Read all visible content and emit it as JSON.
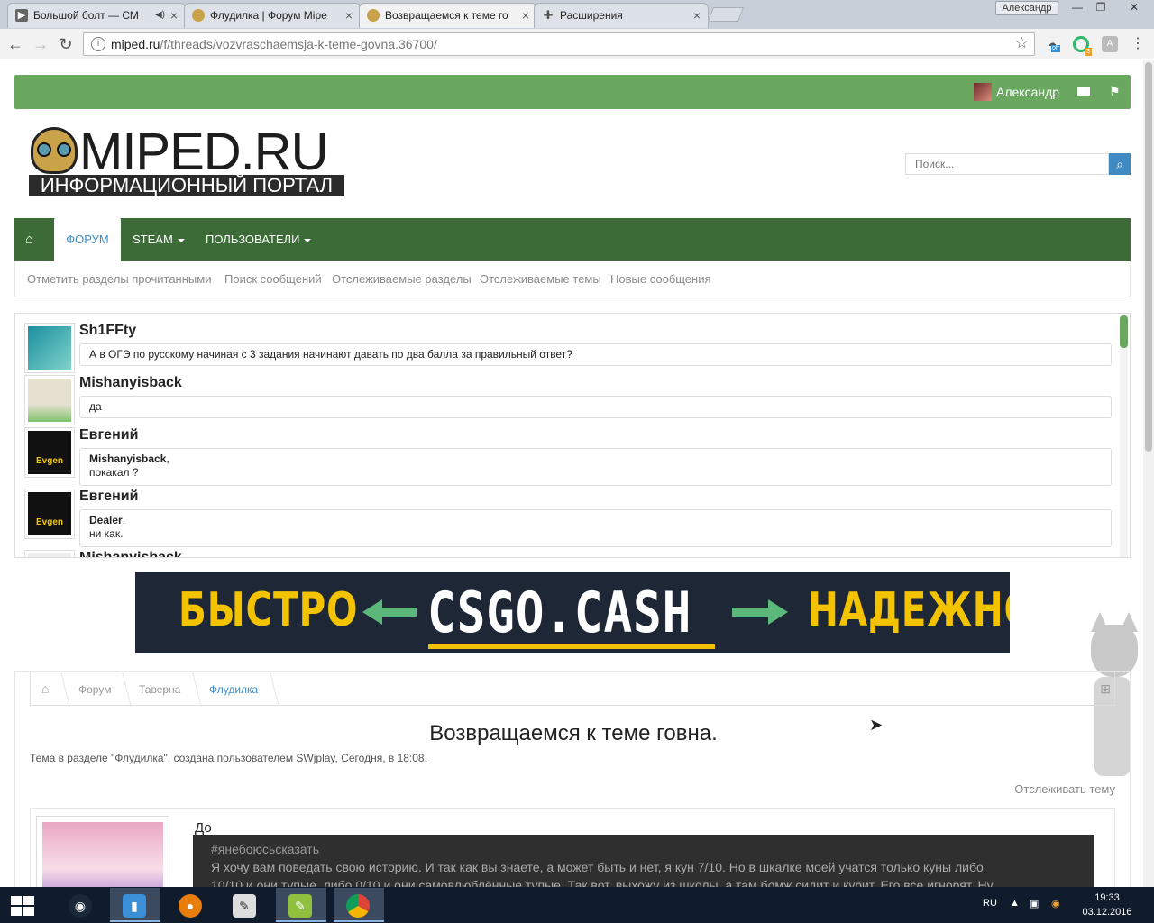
{
  "browser": {
    "tabs": [
      {
        "title": "Большой болт — СМ",
        "icon": "play-icon",
        "active": false
      },
      {
        "title": "Флудилка | Форум Mipe",
        "icon": "miped-favicon",
        "active": false
      },
      {
        "title": "Возвращаемся к теме го",
        "icon": "miped-favicon",
        "active": true
      },
      {
        "title": "Расширения",
        "icon": "puzzle-icon",
        "active": false
      }
    ],
    "profile_name": "Александр",
    "url_domain": "miped.ru",
    "url_path": "/f/threads/vozvraschaemsja-k-teme-govna.36700/",
    "ext_badges": [
      "off",
      "3"
    ]
  },
  "site": {
    "user": "Александр",
    "logo_title": "MIPED.RU",
    "logo_subtitle": "ИНФОРМАЦИОННЫЙ ПОРТАЛ",
    "search_placeholder": "Поиск...",
    "nav": {
      "forum": "ФОРУМ",
      "steam": "STEAM",
      "users": "ПОЛЬЗОВАТЕЛИ"
    },
    "subnav": [
      "Отметить разделы прочитанными",
      "Поиск сообщений",
      "Отслеживаемые разделы",
      "Отслеживаемые темы",
      "Новые сообщения"
    ]
  },
  "shoutbox": [
    {
      "name": "Sh1FFty",
      "lines": [
        "А в ОГЭ по русскому начиная с 3 задания начинают давать по два балла за правильный ответ?"
      ]
    },
    {
      "name": "Mishanyisback",
      "lines": [
        "да"
      ]
    },
    {
      "name": "Евгений",
      "mention": "Mishanyisback",
      "lines": [
        "покакал ?"
      ]
    },
    {
      "name": "Евгений",
      "mention": "Dealer",
      "lines": [
        "ни как."
      ]
    },
    {
      "name": "Mishanyisback",
      "lines": []
    }
  ],
  "banner": {
    "left": "БЫСТРО",
    "mid": "CSGO.CASH",
    "right": "НАДЕЖНО",
    "colors": {
      "yellow": "#f3c300",
      "green": "#5cb87a",
      "bg": "#1e2735"
    }
  },
  "thread": {
    "breadcrumb": [
      "Форум",
      "Таверна",
      "Флудилка"
    ],
    "title": "Возвращаемся к теме говна.",
    "meta": "Тема в разделе \"Флудилка\", создана пользователем SWjplay, Сегодня, в 18:08.",
    "watch": "Отслеживать тему",
    "post_text": "До",
    "quote_tag": "#янебоюсьсказать",
    "quote_line1": "Я хочу вам поведать свою историю. И так как вы знаете, а может быть и нет, я кун 7/10. Но в шкалке моей учатся только куны либо",
    "quote_line2": "10/10 и они тупые, либо 0/10 и они самовлюблённые тупые. Так вот, выхожу из школы, а там бомж сидит и курит. Его все игнорят. Ну"
  },
  "taskbar": {
    "lang": "RU",
    "time": "19:33",
    "date": "03.12.2016"
  },
  "colors": {
    "green_bar": "#6aa860",
    "nav_bg": "#3d6b37",
    "link_blue": "#3e8ec5"
  }
}
